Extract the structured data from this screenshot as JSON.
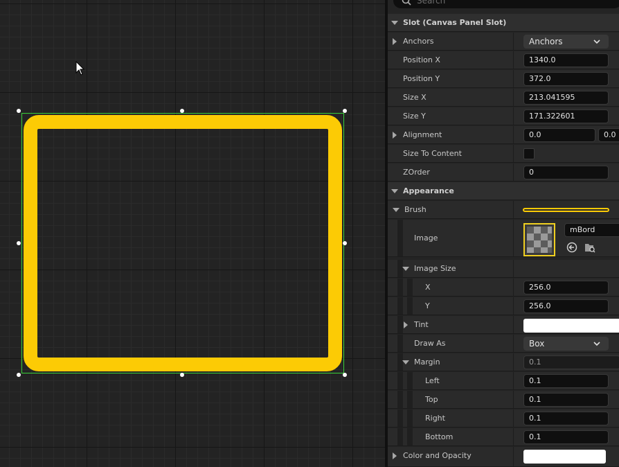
{
  "search": {
    "placeholder": "Search"
  },
  "colors": {
    "image_tint": "#fccb05",
    "selection": "#3ad23a",
    "canvas_bg": "#232323",
    "panel_bg": "#242424"
  },
  "details": {
    "slot_section": "Slot (Canvas Panel Slot)",
    "anchors": {
      "label": "Anchors",
      "value": "Anchors"
    },
    "position_x": {
      "label": "Position X",
      "value": "1340.0"
    },
    "position_y": {
      "label": "Position Y",
      "value": "372.0"
    },
    "size_x": {
      "label": "Size X",
      "value": "213.041595"
    },
    "size_y": {
      "label": "Size Y",
      "value": "171.322601"
    },
    "alignment": {
      "label": "Alignment",
      "x": "0.0",
      "y": "0.0"
    },
    "size_to_content": {
      "label": "Size To Content",
      "checked": false
    },
    "zorder": {
      "label": "ZOrder",
      "value": "0"
    },
    "appearance_section": "Appearance",
    "brush": {
      "label": "Brush"
    },
    "image": {
      "label": "Image",
      "asset": "mBord",
      "icons": [
        "browse-back-icon",
        "find-in-browser-icon"
      ]
    },
    "image_size": {
      "label": "Image Size",
      "x_label": "X",
      "x_value": "256.0",
      "y_label": "Y",
      "y_value": "256.0"
    },
    "tint": {
      "label": "Tint",
      "color": "#ffffff"
    },
    "draw_as": {
      "label": "Draw As",
      "value": "Box"
    },
    "margin": {
      "label": "Margin",
      "value": "0.1",
      "left": {
        "label": "Left",
        "value": "0.1"
      },
      "top": {
        "label": "Top",
        "value": "0.1"
      },
      "right": {
        "label": "Right",
        "value": "0.1"
      },
      "bottom": {
        "label": "Bottom",
        "value": "0.1"
      }
    },
    "color_and_opacity": {
      "label": "Color and Opacity",
      "color": "#ffffff"
    }
  }
}
